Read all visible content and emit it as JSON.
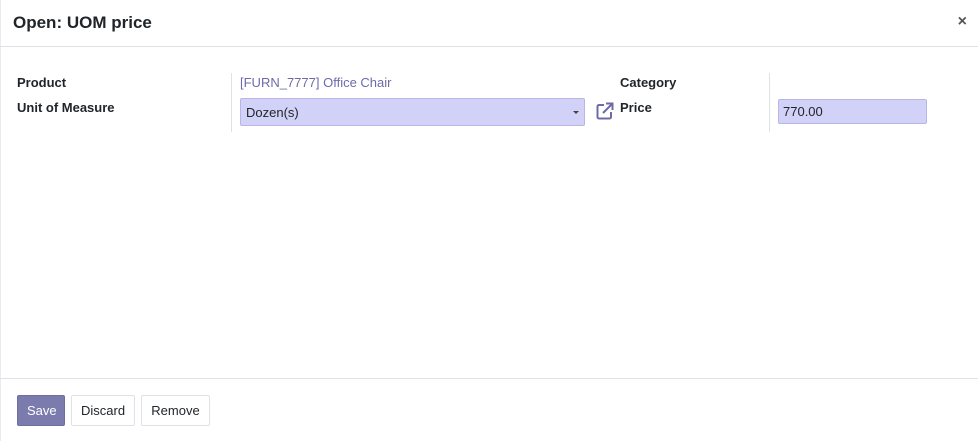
{
  "dialog": {
    "title": "Open: UOM price",
    "close_symbol": "×"
  },
  "form": {
    "product_label": "Product",
    "product_value": "[FURN_7777] Office Chair",
    "uom_label": "Unit of Measure",
    "uom_value": "Dozen(s)",
    "category_label": "Category",
    "category_value": "",
    "price_label": "Price",
    "price_value": "770.00",
    "external_link_icon": "external-link-icon"
  },
  "footer": {
    "save_label": "Save",
    "discard_label": "Discard",
    "remove_label": "Remove"
  },
  "colors": {
    "accent": "#7c7bad",
    "field_background": "#d2d1f7",
    "link": "#6c6ba8"
  }
}
